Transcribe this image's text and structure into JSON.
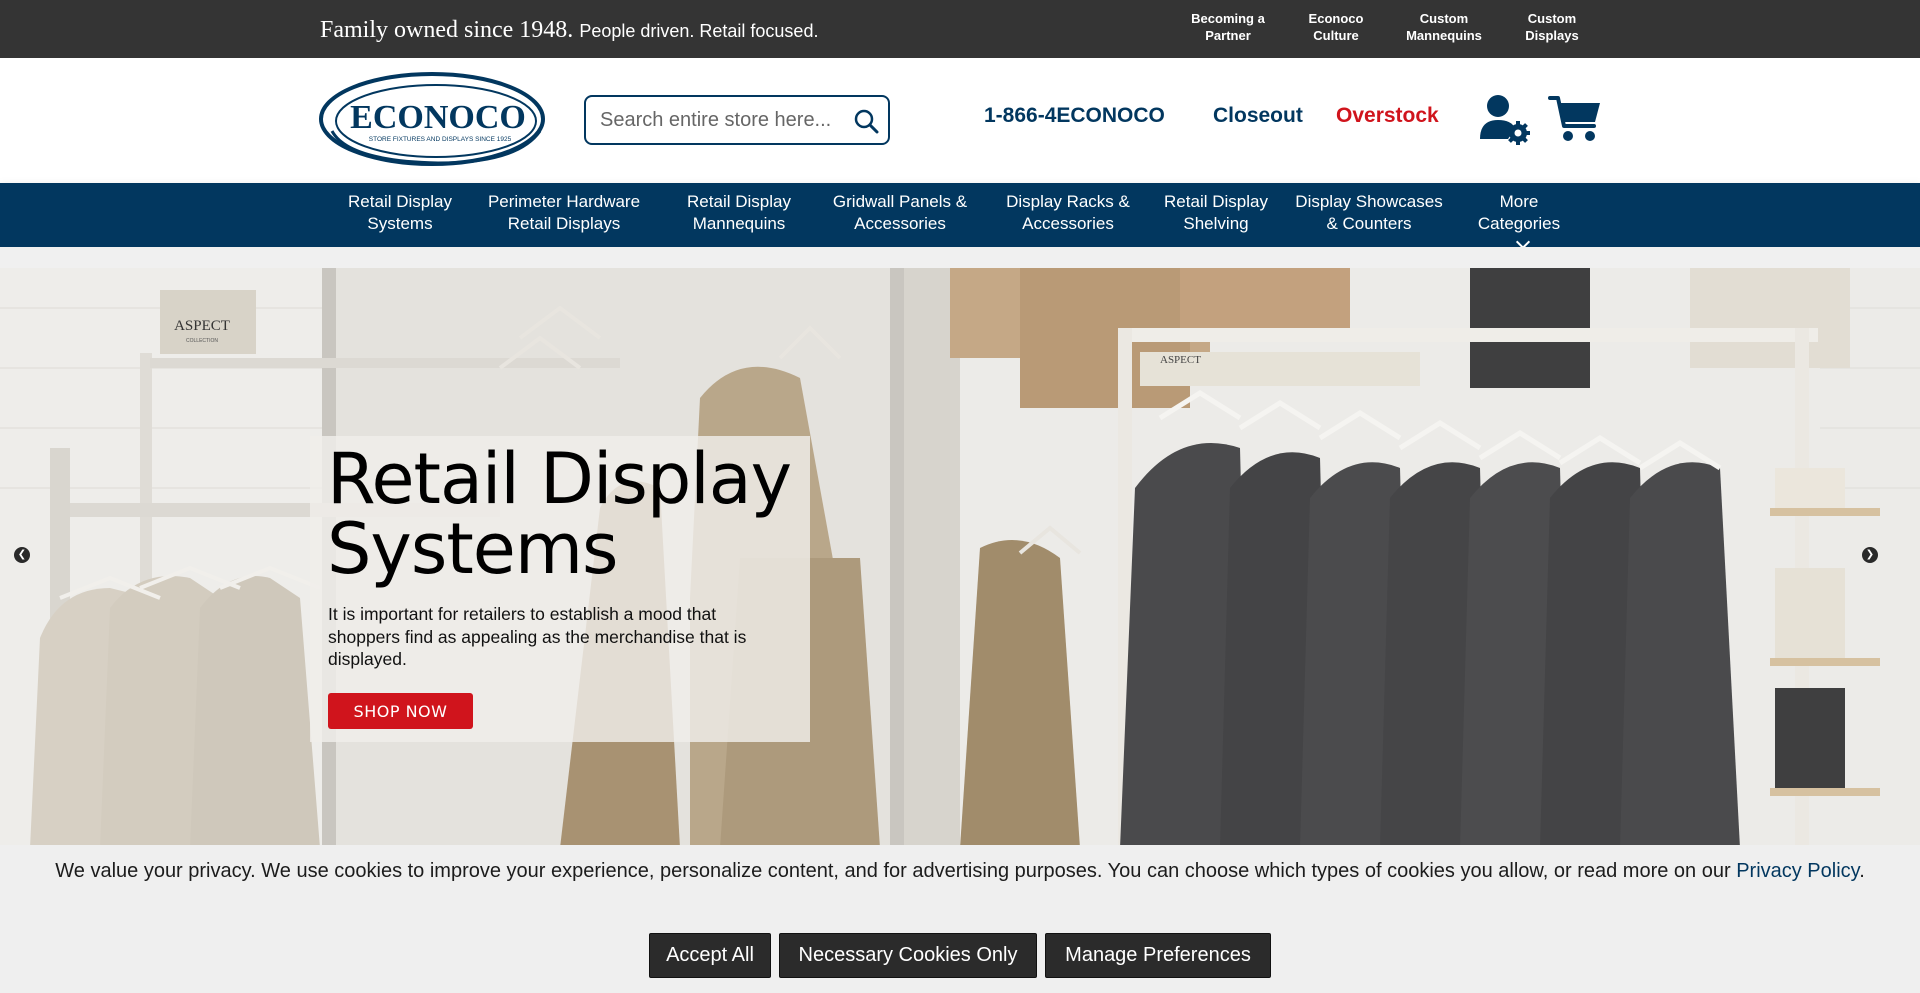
{
  "topbar": {
    "tagline_serif": "Family owned since 1948.",
    "tagline_sans": "People driven. Retail focused.",
    "links": [
      {
        "line1": "Becoming a",
        "line2": "Partner"
      },
      {
        "line1": "Econoco",
        "line2": "Culture"
      },
      {
        "line1": "Custom",
        "line2": "Mannequins"
      },
      {
        "line1": "Custom",
        "line2": "Displays"
      }
    ]
  },
  "header": {
    "logo_text": "ECONOCO",
    "logo_subtext": "STORE FIXTURES AND DISPLAYS SINCE 1925",
    "search_placeholder": "Search entire store here...",
    "phone": "1-866-4ECONOCO",
    "closeout": "Closeout",
    "overstock": "Overstock"
  },
  "nav": {
    "items": [
      {
        "line1": "Retail Display",
        "line2": "Systems"
      },
      {
        "line1": "Perimeter Hardware",
        "line2": "Retail Displays"
      },
      {
        "line1": "Retail Display",
        "line2": "Mannequins"
      },
      {
        "line1": "Gridwall Panels &",
        "line2": "Accessories"
      },
      {
        "line1": "Display Racks &",
        "line2": "Accessories"
      },
      {
        "line1": "Retail Display",
        "line2": "Shelving"
      },
      {
        "line1": "Display Showcases",
        "line2": "& Counters"
      },
      {
        "line1": "More",
        "line2": "Categories"
      }
    ]
  },
  "hero": {
    "title_line1": "Retail Display",
    "title_line2": "Systems",
    "description": "It is important for retailers to establish a mood that shoppers find as appealing as the merchandise that is displayed.",
    "button": "SHOP NOW",
    "sign_left": "ASPECT",
    "sign_left_sub": "COLLECTION",
    "sign_right": "ASPECT"
  },
  "cookie": {
    "text": "We value your privacy. We use cookies to improve your experience, personalize content, and for advertising purposes. You can choose which types of cookies you allow, or read more on our",
    "link": "Privacy Policy",
    "end": ".",
    "buttons": {
      "accept": "Accept All",
      "necessary": "Necessary Cookies Only",
      "manage": "Manage Preferences"
    }
  },
  "colors": {
    "navy": "#02375f",
    "red": "#d0141c",
    "topbar": "#343434"
  }
}
